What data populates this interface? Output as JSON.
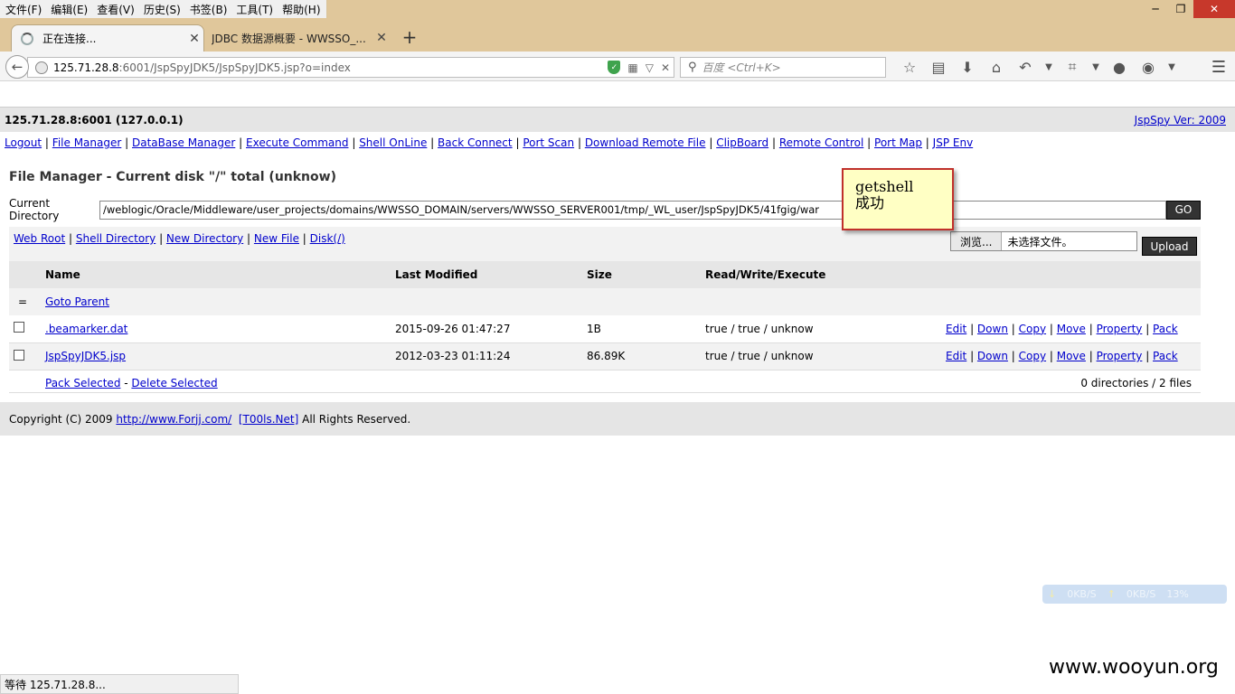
{
  "menubar": [
    "文件(F)",
    "编辑(E)",
    "查看(V)",
    "历史(S)",
    "书签(B)",
    "工具(T)",
    "帮助(H)"
  ],
  "window_controls": {
    "minimize": "─",
    "maximize": "❐",
    "close": "✕"
  },
  "tabs": [
    {
      "label": "正在连接...",
      "active": true
    },
    {
      "label": "JDBC 数据源概要 - WWSSO_...",
      "active": false
    }
  ],
  "newtab_label": "+",
  "addressbar": {
    "host": "125.71.28.8",
    "path": ":6001/JspSpyJDK5/JspSpyJDK5.jsp?o=index"
  },
  "searchbar": {
    "placeholder": "百度 <Ctrl+K>"
  },
  "toolbar_icons": [
    "star-icon",
    "reading-list-icon",
    "download-icon",
    "home-icon",
    "undo-icon",
    "crop-icon",
    "chat-icon",
    "addon-icon",
    "menu-icon"
  ],
  "page": {
    "host_info": "125.71.28.8:6001 (127.0.0.1)",
    "version_link": "JspSpy Ver: 2009",
    "nav_links": [
      "Logout",
      "File Manager",
      "DataBase Manager",
      "Execute Command",
      "Shell OnLine",
      "Back Connect",
      "Port Scan",
      "Download Remote File",
      "ClipBoard",
      "Remote Control",
      "Port Map",
      "JSP Env"
    ],
    "fm_title": "File Manager - Current disk \"/\" total (unknow)",
    "current_dir_label": "Current Directory",
    "current_dir_value": "/weblogic/Oracle/Middleware/user_projects/domains/WWSSO_DOMAIN/servers/WWSSO_SERVER001/tmp/_WL_user/JspSpyJDK5/41fgig/war",
    "go_label": "GO",
    "dir_links": [
      "Web Root",
      "Shell Directory",
      "New Directory",
      "New File",
      "Disk(/)"
    ],
    "browse_label": "浏览...",
    "no_file_label": "未选择文件。",
    "upload_label": "Upload",
    "columns": {
      "name": "Name",
      "modified": "Last Modified",
      "size": "Size",
      "rwx": "Read/Write/Execute"
    },
    "parent_marker": "=",
    "goto_parent": "Goto Parent",
    "files": [
      {
        "name": ".beamarker.dat",
        "modified": "2015-09-26 01:47:27",
        "size": "1B",
        "rwx": "true / true / unknow"
      },
      {
        "name": "JspSpyJDK5.jsp",
        "modified": "2012-03-23 01:11:24",
        "size": "86.89K",
        "rwx": "true / true / unknow"
      }
    ],
    "file_actions": [
      "Edit",
      "Down",
      "Copy",
      "Move",
      "Property",
      "Pack"
    ],
    "pack_selected": "Pack Selected",
    "delete_selected": "Delete Selected",
    "summary": "0 directories / 2 files",
    "footer_prefix": "Copyright (C) 2009",
    "footer_link1": "http://www.Forjj.com/",
    "footer_link2": "[T00ls.Net]",
    "footer_suffix": "All Rights Reserved."
  },
  "annotation": {
    "line1": "getshell",
    "line2": "成功"
  },
  "netmon": {
    "down": "0KB/S",
    "up": "0KB/S",
    "cpu": "13%"
  },
  "status": "等待 125.71.28.8...",
  "watermark": "www.wooyun.org",
  "colors": {
    "link": "#0000cc",
    "chrome": "#e0c79b",
    "close": "#c7382b",
    "note_bg": "#ffffc4",
    "note_border": "#c0302b"
  }
}
